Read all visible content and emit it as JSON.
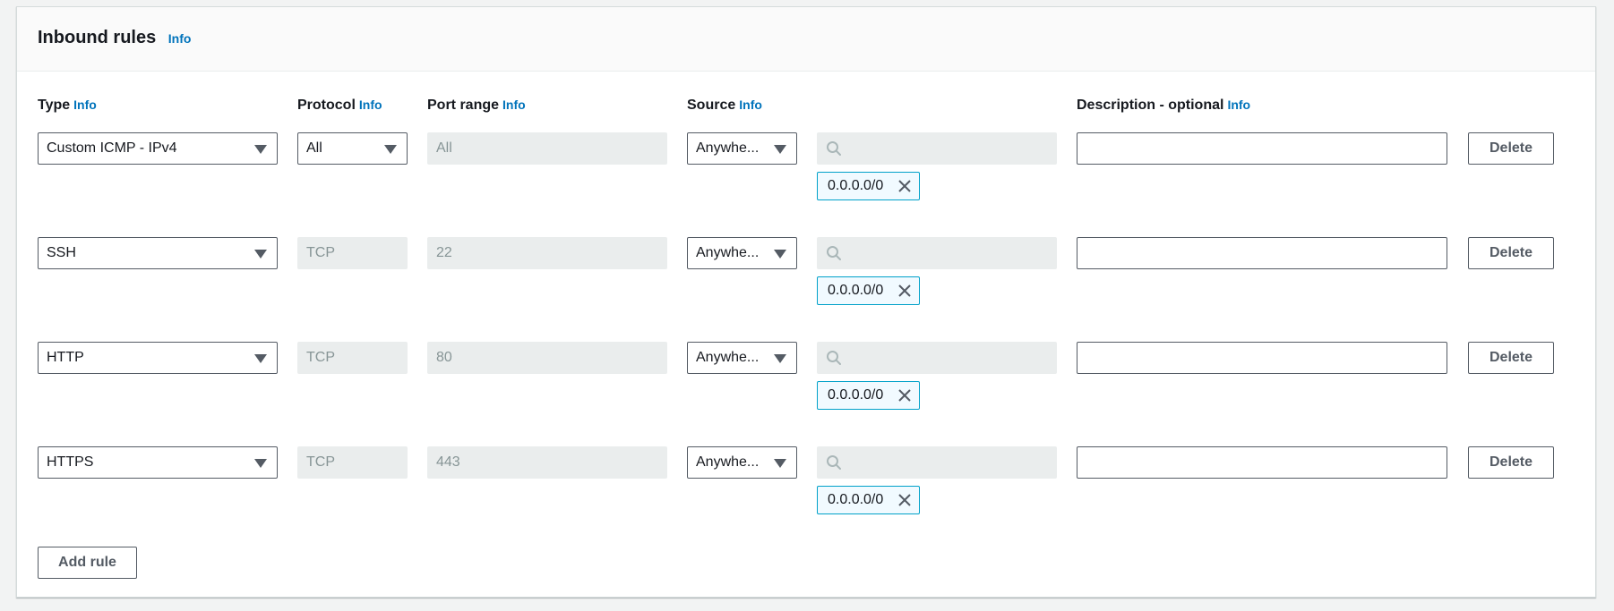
{
  "panel": {
    "title": "Inbound rules",
    "info": "Info"
  },
  "columns": {
    "type": "Type",
    "protocol": "Protocol",
    "port_range": "Port range",
    "source": "Source",
    "description": "Description - optional",
    "info": "Info"
  },
  "rules": [
    {
      "type": "Custom ICMP - IPv4",
      "protocol": "All",
      "protocol_editable": true,
      "port_range": "All",
      "source": "Anywhe...",
      "search_value": "",
      "cidr": "0.0.0.0/0",
      "description": ""
    },
    {
      "type": "SSH",
      "protocol": "TCP",
      "protocol_editable": false,
      "port_range": "22",
      "source": "Anywhe...",
      "search_value": "",
      "cidr": "0.0.0.0/0",
      "description": ""
    },
    {
      "type": "HTTP",
      "protocol": "TCP",
      "protocol_editable": false,
      "port_range": "80",
      "source": "Anywhe...",
      "search_value": "",
      "cidr": "0.0.0.0/0",
      "description": ""
    },
    {
      "type": "HTTPS",
      "protocol": "TCP",
      "protocol_editable": false,
      "port_range": "443",
      "source": "Anywhe...",
      "search_value": "",
      "cidr": "0.0.0.0/0",
      "description": ""
    }
  ],
  "actions": {
    "delete_label": "Delete",
    "add_rule_label": "Add rule"
  },
  "icons": {
    "search": "search-icon",
    "close": "close-icon",
    "caret": "caret-down-icon"
  },
  "colors": {
    "info_link": "#0073bb",
    "token_border": "#00a1c9",
    "token_bg": "#f1faff",
    "disabled_bg": "#eaeded",
    "border": "#545b64"
  }
}
